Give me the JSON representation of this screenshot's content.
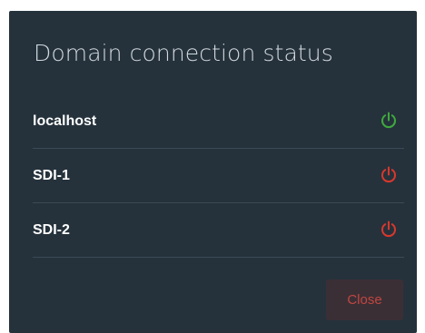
{
  "dialog": {
    "title": "Domain connection status",
    "domains": [
      {
        "name": "localhost",
        "status_icon": "power-icon",
        "status_color": "#3fa93c"
      },
      {
        "name": "SDI-1",
        "status_icon": "power-icon",
        "status_color": "#d9372c"
      },
      {
        "name": "SDI-2",
        "status_icon": "power-icon",
        "status_color": "#d9372c"
      }
    ],
    "close_label": "Close"
  }
}
